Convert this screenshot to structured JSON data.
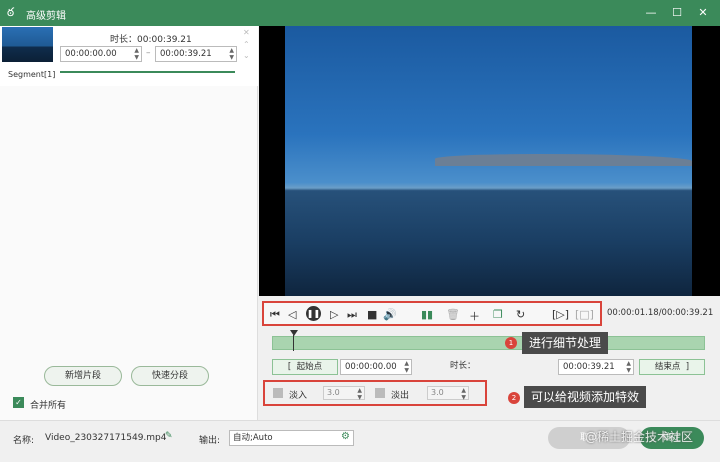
{
  "window": {
    "title": "高级剪辑",
    "minimize": "—",
    "maximize": "☐",
    "close": "✕"
  },
  "segment": {
    "duration": "时长：00:00:39.21",
    "start": "00:00:00.00",
    "end": "00:00:39.21",
    "separator": "–",
    "label": "Segment[1]",
    "progress": 1.0
  },
  "left_buttons": {
    "add_segment": "新增片段",
    "quick_split": "快速分段"
  },
  "merge_all": {
    "label": "合并所有",
    "checked": true
  },
  "player": {
    "time": "00:00:01.18/00:00:39.21"
  },
  "range": {
    "start_btn": "起始点",
    "start_value": "00:00:00.00",
    "duration_label": "时长：",
    "duration_value": "00:00:39.21",
    "end_btn": "结束点"
  },
  "effects": {
    "fade_in_label": "淡入",
    "fade_in_value": "3.0",
    "fade_out_label": "淡出",
    "fade_out_value": "3.0"
  },
  "annotations": [
    {
      "badge": "1",
      "text": "进行细节处理"
    },
    {
      "badge": "2",
      "text": "可以给视频添加特效"
    }
  ],
  "bottom": {
    "name_label": "名称:",
    "name_value": "Video_230327171549.mp4",
    "output_label": "输出:",
    "output_value": "自动;Auto",
    "cancel": "取消",
    "ok": "确定"
  },
  "watermark": "@稀土掘金技术社区",
  "colors": {
    "accent": "#3b8a5a",
    "highlight": "#d9443b"
  }
}
